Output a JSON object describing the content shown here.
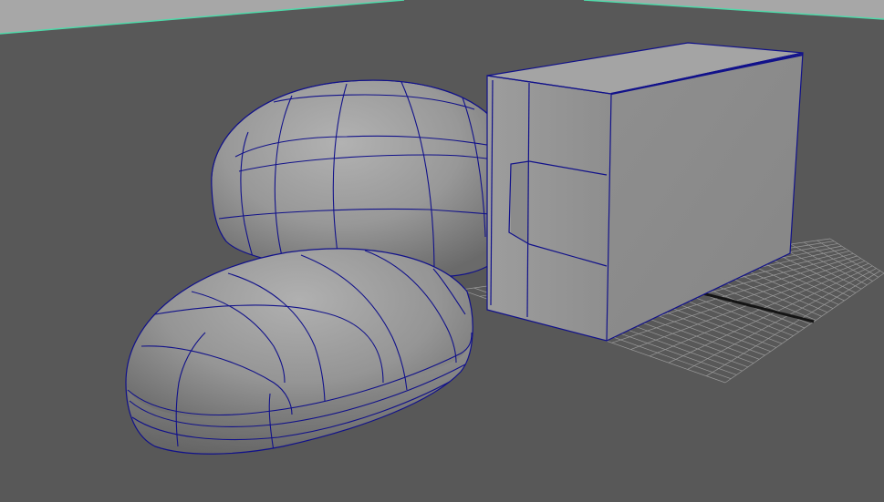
{
  "viewport": {
    "background_color": "#585858",
    "horizon_sky_color": "#a7a7a7",
    "horizon_line_color": "#4fd9a9",
    "grid_color": "#9a9a9a",
    "grid_axis_color": "#141414",
    "wireframe_color": "#11118a",
    "objects": [
      {
        "name": "back-egg-mesh"
      },
      {
        "name": "front-pebble-mesh"
      },
      {
        "name": "box-mesh"
      }
    ]
  }
}
